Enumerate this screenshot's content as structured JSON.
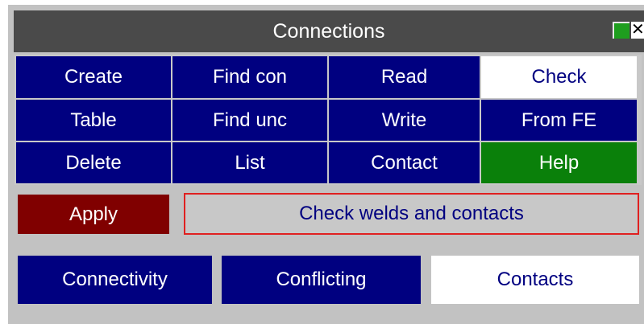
{
  "window": {
    "title": "Connections",
    "close_glyph": "✕",
    "icons": [
      "green-square-icon",
      "close-icon"
    ],
    "colors": {
      "panel_bg": "#c2c2c2",
      "titlebar_bg": "#4a4a4a",
      "button_navy": "#000080",
      "button_selected": "#ffffff",
      "help_green": "#0a800a",
      "apply_red": "#800000",
      "desc_border": "#e02020"
    }
  },
  "menu": {
    "row1": [
      "Create",
      "Find con",
      "Read",
      "Check"
    ],
    "row2": [
      "Table",
      "Find unc",
      "Write",
      "From FE"
    ],
    "row3": [
      "Delete",
      "List",
      "Contact",
      "Help"
    ],
    "selected": "Check"
  },
  "action": {
    "apply_label": "Apply",
    "description": "Check welds and contacts"
  },
  "tabs": {
    "items": [
      "Connectivity",
      "Conflicting",
      "Contacts"
    ],
    "selected": "Contacts"
  }
}
